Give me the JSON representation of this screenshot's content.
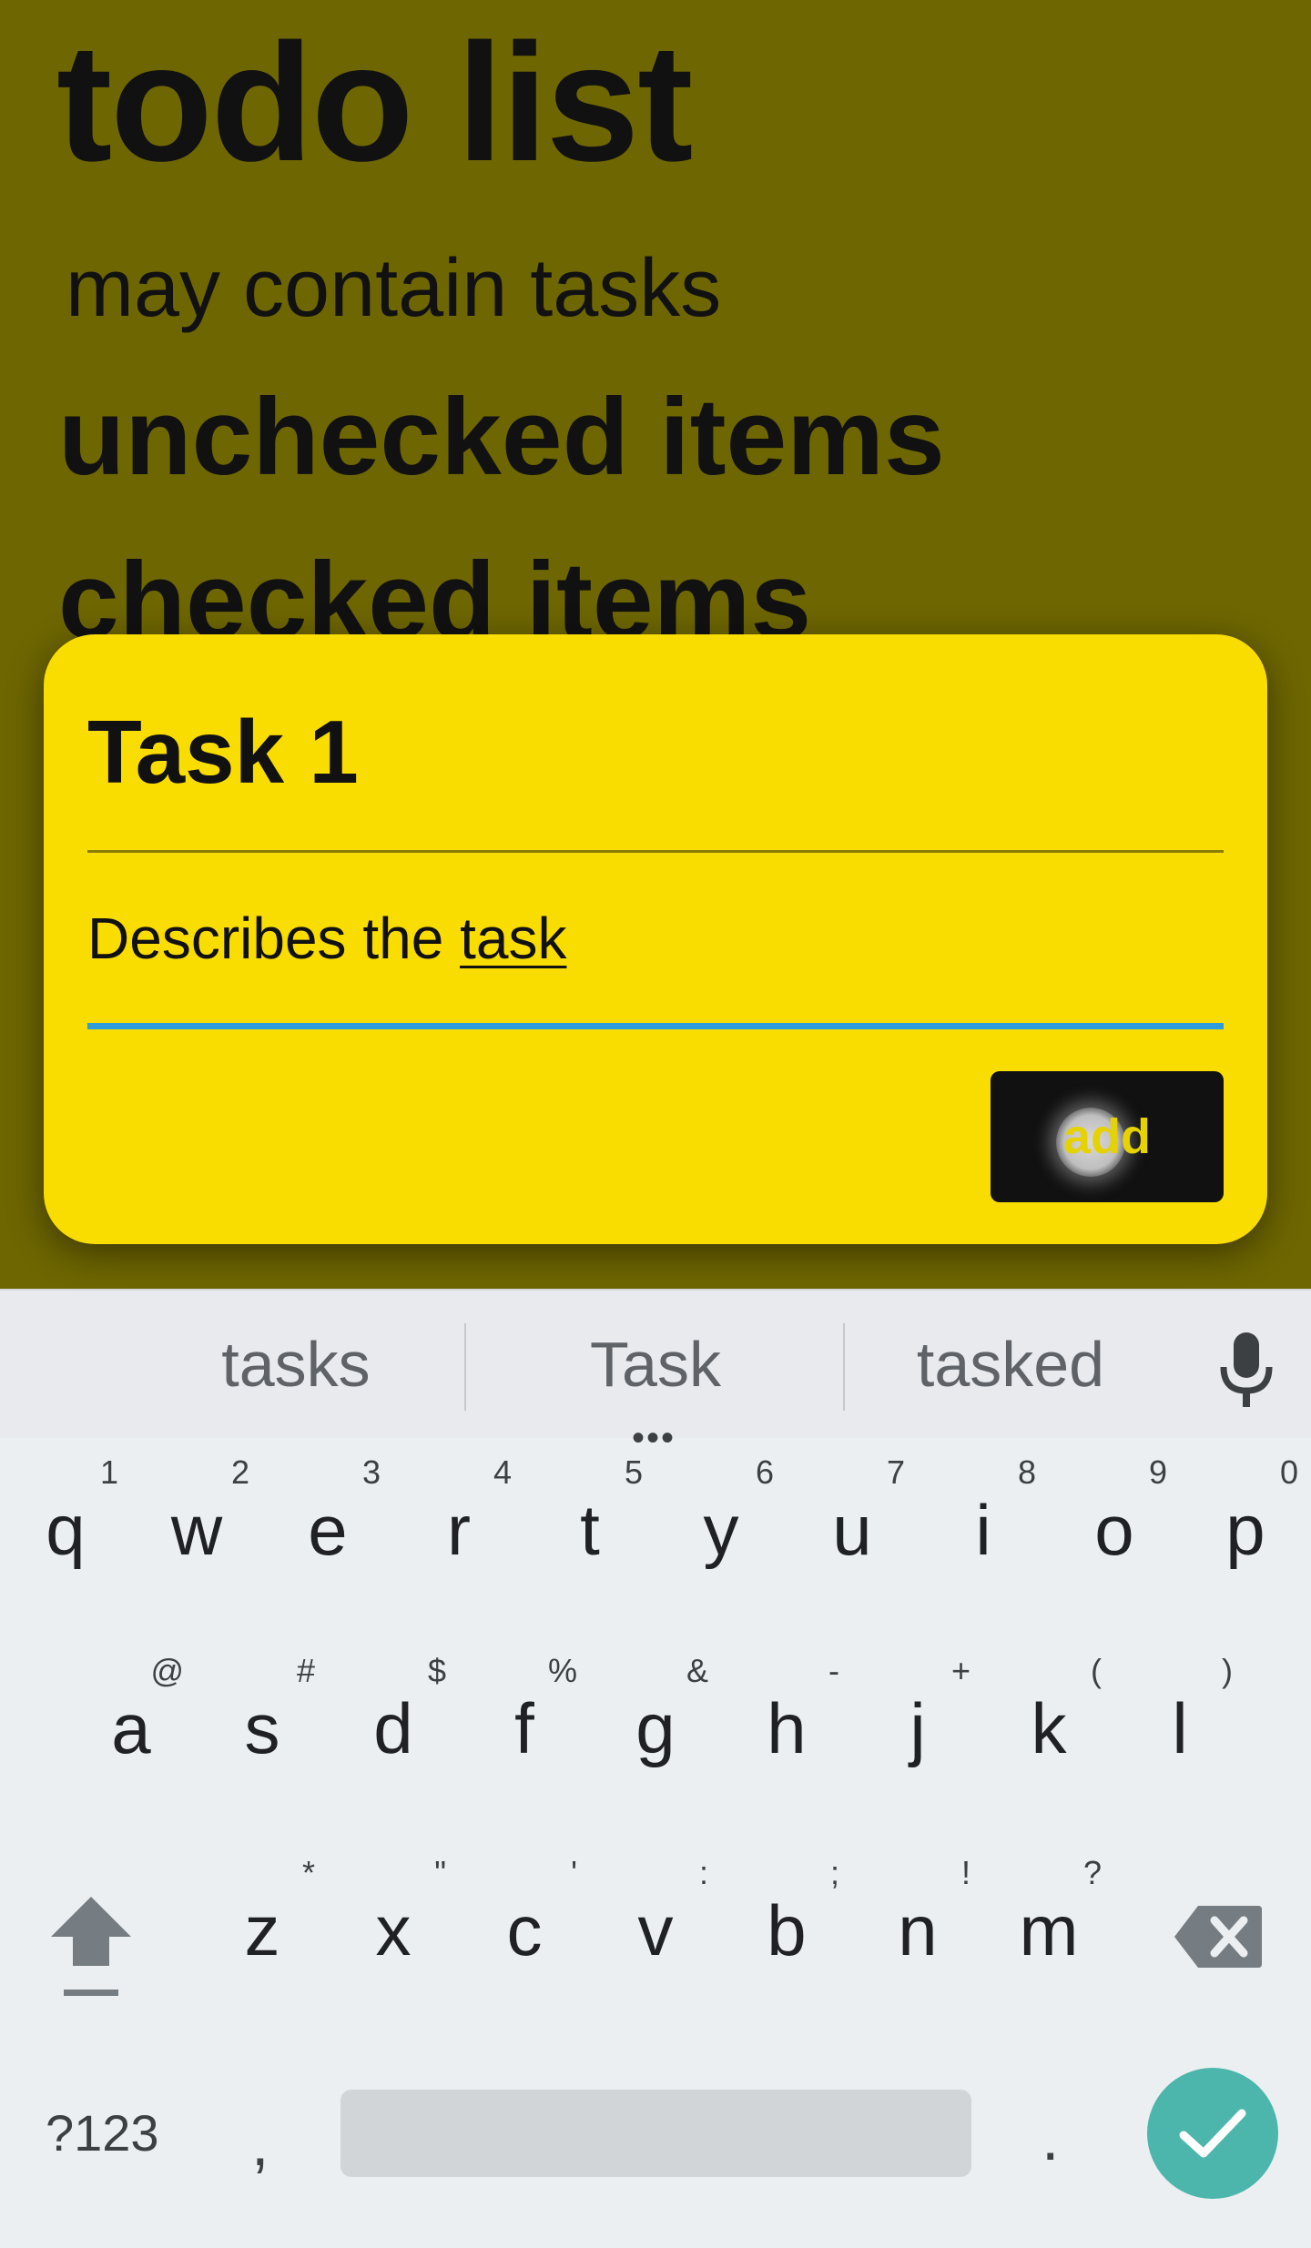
{
  "page": {
    "title": "todo list",
    "subtitle": "may contain tasks",
    "unchecked_heading": "unchecked items",
    "checked_heading": "checked items"
  },
  "dialog": {
    "title_value": "Task 1",
    "description_value_prefix": "Describes the ",
    "description_value_underlined": "task",
    "add_label": "add"
  },
  "keyboard": {
    "suggestions": [
      "tasks",
      "Task",
      "tasked"
    ],
    "suggestion_dots": "•••",
    "row1": [
      {
        "key": "q",
        "hint": "1"
      },
      {
        "key": "w",
        "hint": "2"
      },
      {
        "key": "e",
        "hint": "3"
      },
      {
        "key": "r",
        "hint": "4"
      },
      {
        "key": "t",
        "hint": "5"
      },
      {
        "key": "y",
        "hint": "6"
      },
      {
        "key": "u",
        "hint": "7"
      },
      {
        "key": "i",
        "hint": "8"
      },
      {
        "key": "o",
        "hint": "9"
      },
      {
        "key": "p",
        "hint": "0"
      }
    ],
    "row2": [
      {
        "key": "a",
        "hint": "@"
      },
      {
        "key": "s",
        "hint": "#"
      },
      {
        "key": "d",
        "hint": "$"
      },
      {
        "key": "f",
        "hint": "%"
      },
      {
        "key": "g",
        "hint": "&"
      },
      {
        "key": "h",
        "hint": "-"
      },
      {
        "key": "j",
        "hint": "+"
      },
      {
        "key": "k",
        "hint": "("
      },
      {
        "key": "l",
        "hint": ")"
      }
    ],
    "row3": [
      {
        "key": "z",
        "hint": "*"
      },
      {
        "key": "x",
        "hint": "\""
      },
      {
        "key": "c",
        "hint": "'"
      },
      {
        "key": "v",
        "hint": ":"
      },
      {
        "key": "b",
        "hint": ";"
      },
      {
        "key": "n",
        "hint": "!"
      },
      {
        "key": "m",
        "hint": "?"
      }
    ],
    "symbols_label": "?123",
    "comma_label": ",",
    "period_label": "."
  },
  "icons": {
    "mic": "microphone-icon",
    "shift": "shift-icon",
    "backspace": "backspace-icon",
    "enter": "checkmark-icon"
  },
  "colors": {
    "dialog_bg": "#f9dc00",
    "scrim_bg": "#6e6600",
    "input_focus": "#2d9cdb",
    "enter_key": "#4db6ac"
  }
}
